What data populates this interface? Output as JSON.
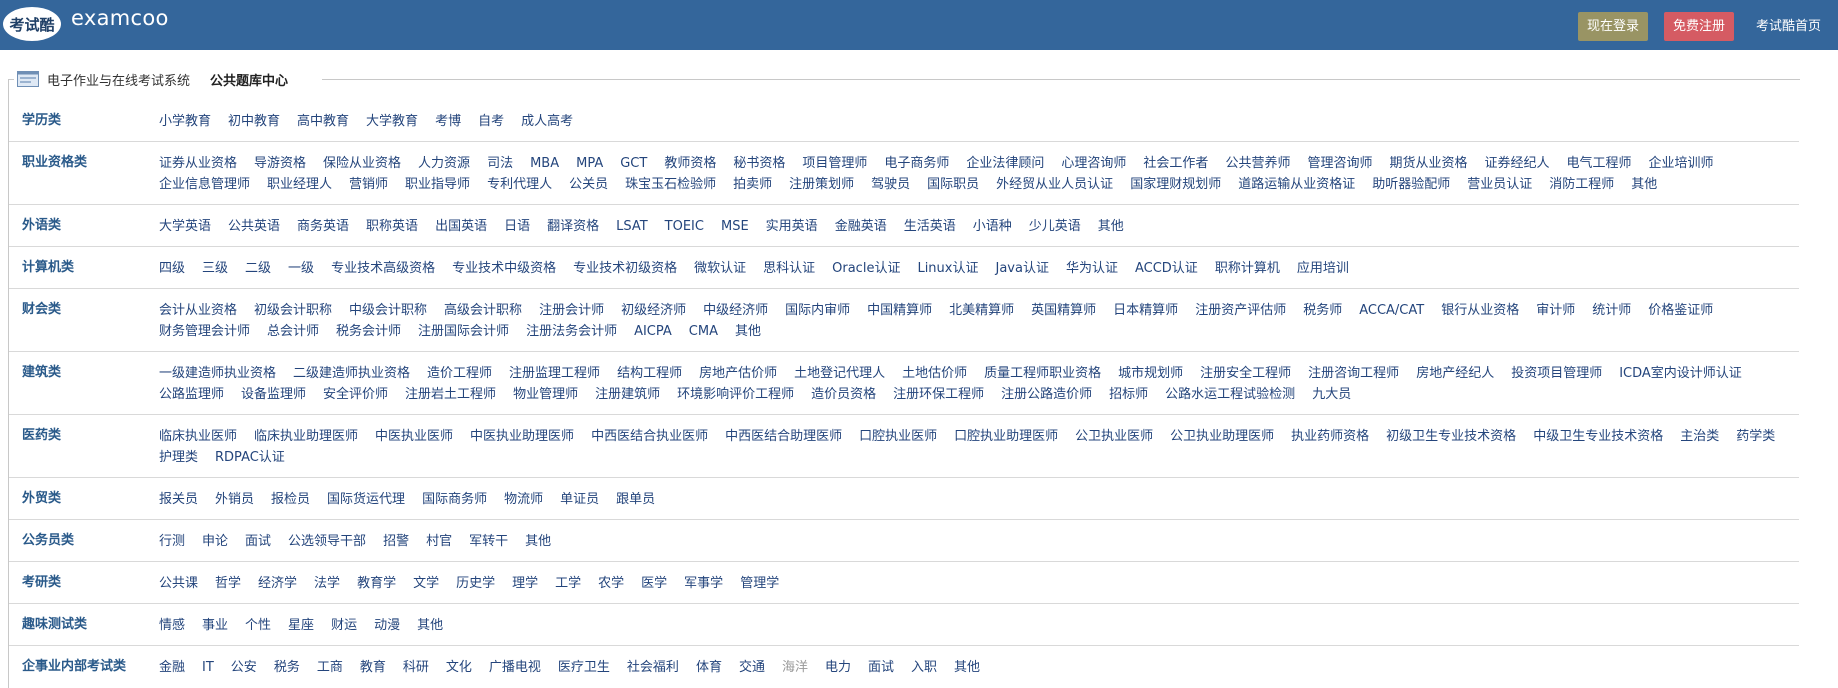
{
  "header": {
    "brand": "examcoo",
    "logo_text": "考试酷",
    "login_label": "现在登录",
    "register_label": "免费注册",
    "home_label": "考试酷首页",
    "login_color": "#999464",
    "register_color": "#d55b63",
    "bar_color": "#34669b"
  },
  "legend": {
    "system_label": "电子作业与在线考试系统",
    "current_label": "公共题库中心",
    "icon": "window-icon"
  },
  "categories": [
    {
      "title": "学历类",
      "items": [
        "小学教育",
        "初中教育",
        "高中教育",
        "大学教育",
        "考博",
        "自考",
        "成人高考"
      ]
    },
    {
      "title": "职业资格类",
      "items": [
        "证券从业资格",
        "导游资格",
        "保险从业资格",
        "人力资源",
        "司法",
        "MBA",
        "MPA",
        "GCT",
        "教师资格",
        "秘书资格",
        "项目管理师",
        "电子商务师",
        "企业法律顾问",
        "心理咨询师",
        "社会工作者",
        "公共营养师",
        "管理咨询师",
        "期货从业资格",
        "证券经纪人",
        "电气工程师",
        "企业培训师",
        "企业信息管理师",
        "职业经理人",
        "营销师",
        "职业指导师",
        "专利代理人",
        "公关员",
        "珠宝玉石检验师",
        "拍卖师",
        "注册策划师",
        "驾驶员",
        "国际职员",
        "外经贸从业人员认证",
        "国家理财规划师",
        "道路运输从业资格证",
        "助听器验配师",
        "营业员认证",
        "消防工程师",
        "其他"
      ]
    },
    {
      "title": "外语类",
      "items": [
        "大学英语",
        "公共英语",
        "商务英语",
        "职称英语",
        "出国英语",
        "日语",
        "翻译资格",
        "LSAT",
        "TOEIC",
        "MSE",
        "实用英语",
        "金融英语",
        "生活英语",
        "小语种",
        "少儿英语",
        "其他"
      ]
    },
    {
      "title": "计算机类",
      "items": [
        "四级",
        "三级",
        "二级",
        "一级",
        "专业技术高级资格",
        "专业技术中级资格",
        "专业技术初级资格",
        "微软认证",
        "思科认证",
        "Oracle认证",
        "Linux认证",
        "Java认证",
        "华为认证",
        "ACCD认证",
        "职称计算机",
        "应用培训"
      ]
    },
    {
      "title": "财会类",
      "items": [
        "会计从业资格",
        "初级会计职称",
        "中级会计职称",
        "高级会计职称",
        "注册会计师",
        "初级经济师",
        "中级经济师",
        "国际内审师",
        "中国精算师",
        "北美精算师",
        "英国精算师",
        "日本精算师",
        "注册资产评估师",
        "税务师",
        "ACCA/CAT",
        "银行从业资格",
        "审计师",
        "统计师",
        "价格鉴证师",
        "财务管理会计师",
        "总会计师",
        "税务会计师",
        "注册国际会计师",
        "注册法务会计师",
        "AICPA",
        "CMA",
        "其他"
      ]
    },
    {
      "title": "建筑类",
      "items": [
        "一级建造师执业资格",
        "二级建造师执业资格",
        "造价工程师",
        "注册监理工程师",
        "结构工程师",
        "房地产估价师",
        "土地登记代理人",
        "土地估价师",
        "质量工程师职业资格",
        "城市规划师",
        "注册安全工程师",
        "注册咨询工程师",
        "房地产经纪人",
        "投资项目管理师",
        "ICDA室内设计师认证",
        "公路监理师",
        "设备监理师",
        "安全评价师",
        "注册岩土工程师",
        "物业管理师",
        "注册建筑师",
        "环境影响评价工程师",
        "造价员资格",
        "注册环保工程师",
        "注册公路造价师",
        "招标师",
        "公路水运工程试验检测",
        "九大员"
      ]
    },
    {
      "title": "医药类",
      "items": [
        "临床执业医师",
        "临床执业助理医师",
        "中医执业医师",
        "中医执业助理医师",
        "中西医结合执业医师",
        "中西医结合助理医师",
        "口腔执业医师",
        "口腔执业助理医师",
        "公卫执业医师",
        "公卫执业助理医师",
        "执业药师资格",
        "初级卫生专业技术资格",
        "中级卫生专业技术资格",
        "主治类",
        "药学类",
        "护理类",
        "RDPAC认证"
      ]
    },
    {
      "title": "外贸类",
      "items": [
        "报关员",
        "外销员",
        "报检员",
        "国际货运代理",
        "国际商务师",
        "物流师",
        "单证员",
        "跟单员"
      ]
    },
    {
      "title": "公务员类",
      "items": [
        "行测",
        "申论",
        "面试",
        "公选领导干部",
        "招警",
        "村官",
        "军转干",
        "其他"
      ]
    },
    {
      "title": "考研类",
      "items": [
        "公共课",
        "哲学",
        "经济学",
        "法学",
        "教育学",
        "文学",
        "历史学",
        "理学",
        "工学",
        "农学",
        "医学",
        "军事学",
        "管理学"
      ]
    },
    {
      "title": "趣味测试类",
      "items": [
        "情感",
        "事业",
        "个性",
        "星座",
        "财运",
        "动漫",
        "其他"
      ]
    },
    {
      "title": "企事业内部考试类",
      "items": [
        "金融",
        "IT",
        "公安",
        "税务",
        "工商",
        "教育",
        "科研",
        "文化",
        "广播电视",
        "医疗卫生",
        "社会福利",
        "体育",
        "交通",
        "海洋",
        "电力",
        "面试",
        "入职",
        "其他"
      ],
      "muted_items": [
        "海洋"
      ]
    }
  ]
}
